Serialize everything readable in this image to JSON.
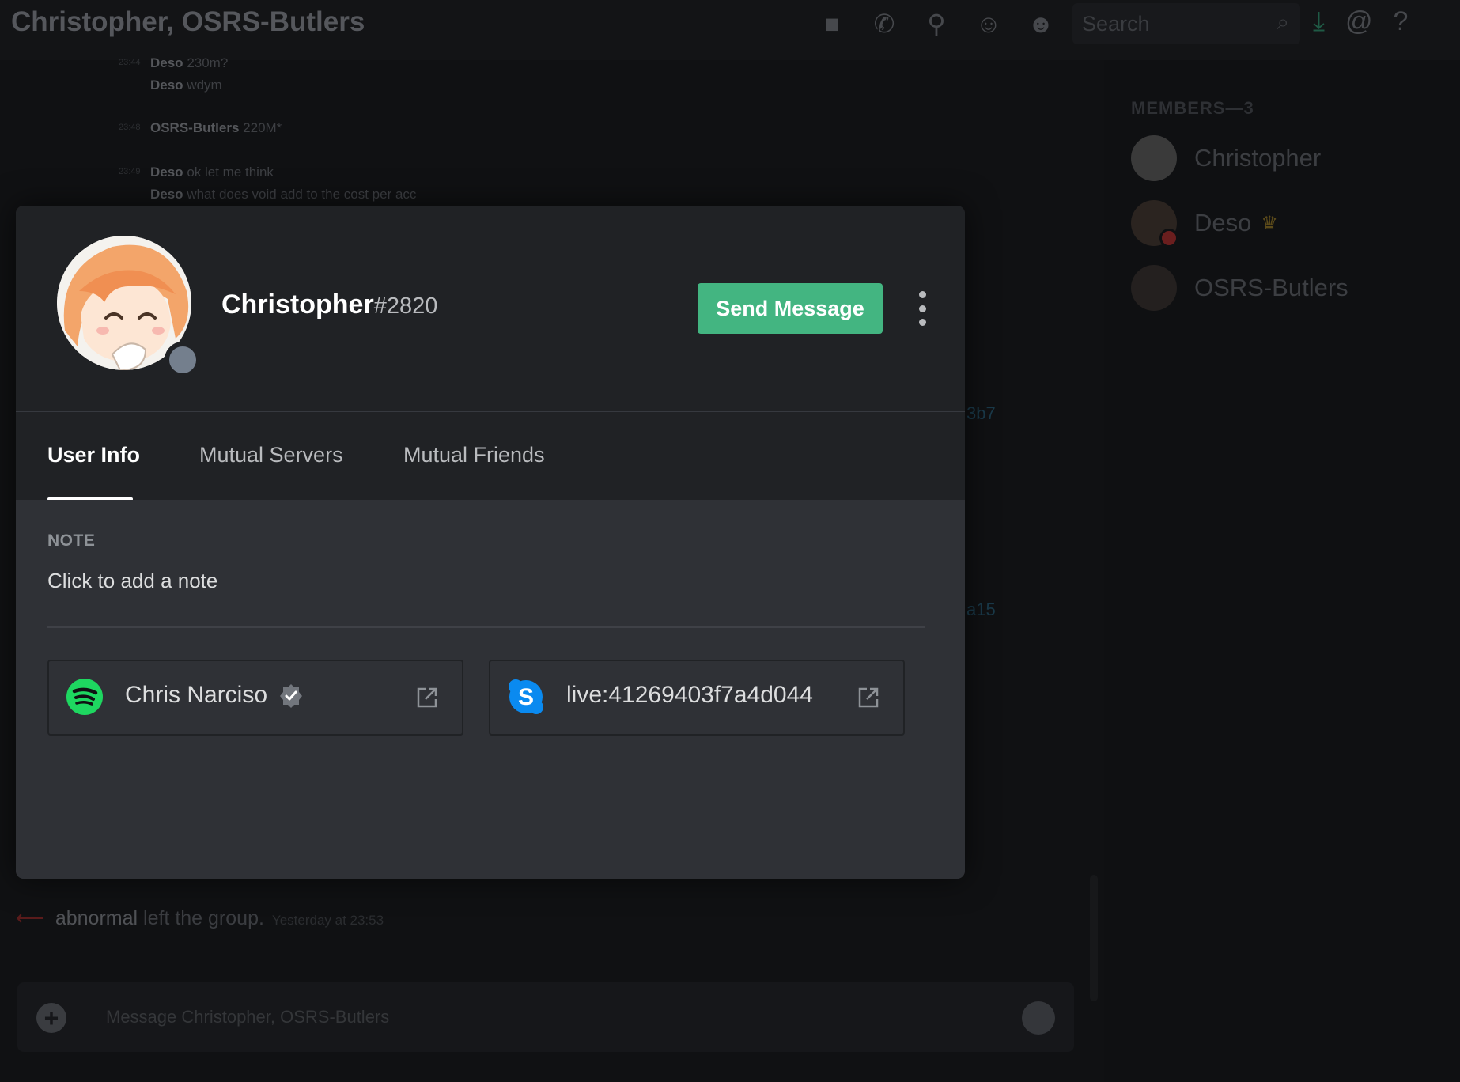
{
  "header": {
    "channel_title": "Christopher, OSRS-Butlers",
    "icons": [
      "video-icon",
      "phone-icon",
      "pin-icon",
      "add-friend-icon",
      "members-icon"
    ],
    "search_placeholder": "Search",
    "right_icons": [
      "download-icon",
      "mention-icon",
      "help-icon"
    ]
  },
  "chat": {
    "messages": [
      {
        "author": "Deso",
        "text": "230m?"
      },
      {
        "author": "Deso",
        "text": "wdym"
      },
      {
        "author": "OSRS-Butlers",
        "text": "220M*"
      },
      {
        "author": "Deso",
        "text": "ok let me think"
      },
      {
        "author": "Deso",
        "text": "what does void add to the cost per acc"
      }
    ],
    "link_fragments": [
      "3b7",
      "a15"
    ],
    "system": {
      "user": "abnormal",
      "text": "left the group.",
      "timestamp": "Yesterday at 23:53"
    },
    "composer_placeholder": "Message Christopher, OSRS-Butlers"
  },
  "members": {
    "heading": "MEMBERS—3",
    "list": [
      {
        "name": "Christopher"
      },
      {
        "name": "Deso",
        "owner": true
      },
      {
        "name": "OSRS-Butlers"
      }
    ]
  },
  "profile": {
    "username": "Christopher",
    "discriminator": "#2820",
    "status": "offline",
    "send_message_label": "Send Message",
    "tabs": [
      {
        "label": "User Info",
        "active": true
      },
      {
        "label": "Mutual Servers",
        "active": false
      },
      {
        "label": "Mutual Friends",
        "active": false
      }
    ],
    "note_label": "NOTE",
    "note_placeholder": "Click to add a note",
    "connections": [
      {
        "service": "spotify",
        "name": "Chris Narciso",
        "verified": true
      },
      {
        "service": "skype",
        "name": "live:41269403f7a4d044",
        "verified": false
      }
    ]
  },
  "colors": {
    "send_button": "#43b581",
    "spotify": "#1ed760",
    "skype": "#0a8af0",
    "status_offline": "#747f8d"
  }
}
